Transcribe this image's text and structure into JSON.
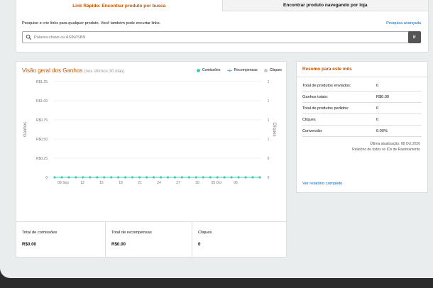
{
  "tabs": [
    {
      "label": "Link Rápido: Encontrar produto por busca"
    },
    {
      "label": "Encontrar produto navegando por loja"
    }
  ],
  "builder": {
    "hint": "Pesquise e crie links para qualquer produto. Você também pode encurtar links.",
    "advanced_link": "Pesquisa avançada",
    "search_placeholder": "Palavra-chave ou ASIN/ISBN",
    "go_label": "Ir"
  },
  "earnings": {
    "title": "Visão geral dos Ganhos",
    "subtitle": "(nos últimos 30 dias)",
    "legend": [
      {
        "name": "Comissões",
        "color": "#3ecfb2"
      },
      {
        "name": "Recompensas",
        "color": "#7eb6e0"
      },
      {
        "name": "Cliques",
        "color": "#c8c8c8"
      }
    ],
    "totals": [
      {
        "label": "Total de comissões",
        "value": "R$0.00"
      },
      {
        "label": "Total de recompensas",
        "value": "R$0.00"
      },
      {
        "label": "Cliques",
        "value": "0"
      }
    ]
  },
  "chart_data": {
    "type": "line",
    "ylabel": "Ganhos",
    "ylabel_right": "Cliques",
    "y_ticks": [
      "R$1.25",
      "R$1.00",
      "R$0.75",
      "R$0.50",
      "R$0.25",
      "0"
    ],
    "y_right_ticks": [
      "1",
      "1",
      "1",
      "1",
      "0",
      "0"
    ],
    "ylim": [
      0,
      1.25
    ],
    "x_tick_labels": [
      "09 Sep",
      "12",
      "15",
      "18",
      "21",
      "24",
      "27",
      "30",
      "05 Oct",
      "06"
    ],
    "series": [
      {
        "name": "Comissões",
        "color": "#3ecfb2",
        "values": [
          0,
          0,
          0,
          0,
          0,
          0,
          0,
          0,
          0,
          0,
          0,
          0,
          0,
          0,
          0,
          0,
          0,
          0,
          0,
          0,
          0,
          0,
          0,
          0,
          0,
          0,
          0,
          0,
          0,
          0
        ]
      }
    ],
    "grid": true
  },
  "summary": {
    "title": "Resumo para este mês",
    "rows": [
      {
        "label": "Total de produtos enviados:",
        "value": "0"
      },
      {
        "label": "Ganhos totais:",
        "value": "R$0.00"
      },
      {
        "label": "Total de produtos pedidos:",
        "value": "0"
      },
      {
        "label": "Cliques",
        "value": "0"
      },
      {
        "label": "Conversão:",
        "value": "0.00%"
      }
    ],
    "last_update": "Última atualização: 08 Oct 2020",
    "report_scope": "Relatório de todos os IDs de Rastreamento",
    "full_report_link": "Ver relatório completo"
  }
}
